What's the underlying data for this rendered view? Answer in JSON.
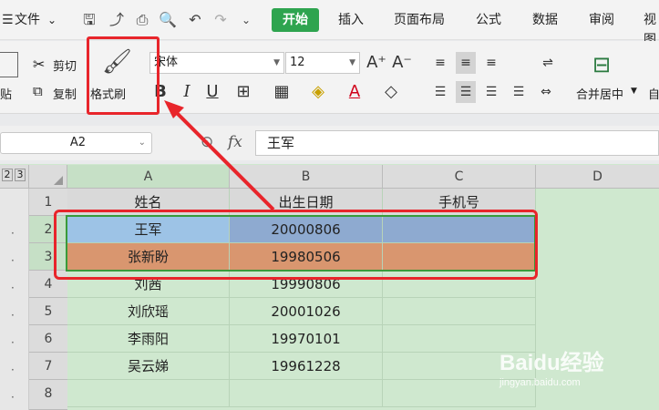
{
  "menu": {
    "file": "文件",
    "start_tab": "开始",
    "tabs": [
      "插入",
      "页面布局",
      "公式",
      "数据",
      "审阅",
      "视图"
    ]
  },
  "ribbon": {
    "cut": "剪切",
    "copy": "复制",
    "paste": "贴",
    "format_painter": "格式刷",
    "font_name": "宋体",
    "font_size": "12",
    "bold": "B",
    "italic": "I",
    "underline": "U",
    "merge_center": "合并居中",
    "auto": "自"
  },
  "formula_bar": {
    "cell_ref": "A2",
    "fx": "fx",
    "value": "王军"
  },
  "outline_levels": [
    "2",
    "3"
  ],
  "columns": [
    "A",
    "B",
    "C",
    "D"
  ],
  "rows": [
    {
      "num": "1",
      "a": "姓名",
      "b": "出生日期",
      "c": "手机号"
    },
    {
      "num": "2",
      "a": "王军",
      "b": "20000806",
      "c": ""
    },
    {
      "num": "3",
      "a": "张新盼",
      "b": "19980506",
      "c": ""
    },
    {
      "num": "4",
      "a": "刘茜",
      "b": "19990806",
      "c": ""
    },
    {
      "num": "5",
      "a": "刘欣瑶",
      "b": "20001026",
      "c": ""
    },
    {
      "num": "6",
      "a": "李雨阳",
      "b": "19970101",
      "c": ""
    },
    {
      "num": "7",
      "a": "吴云娣",
      "b": "19961228",
      "c": ""
    },
    {
      "num": "8",
      "a": "",
      "b": "",
      "c": ""
    }
  ],
  "colors": {
    "row2_a": "#9dc3e6",
    "row2_bc": "#8eaad0",
    "row3": "#d9967a",
    "highlight": "#e8252b",
    "sheet_bg": "#cfe8cf",
    "active_tab": "#2ea44f"
  },
  "watermark": {
    "brand": "Baidu经验",
    "url": "jingyan.baidu.com"
  }
}
